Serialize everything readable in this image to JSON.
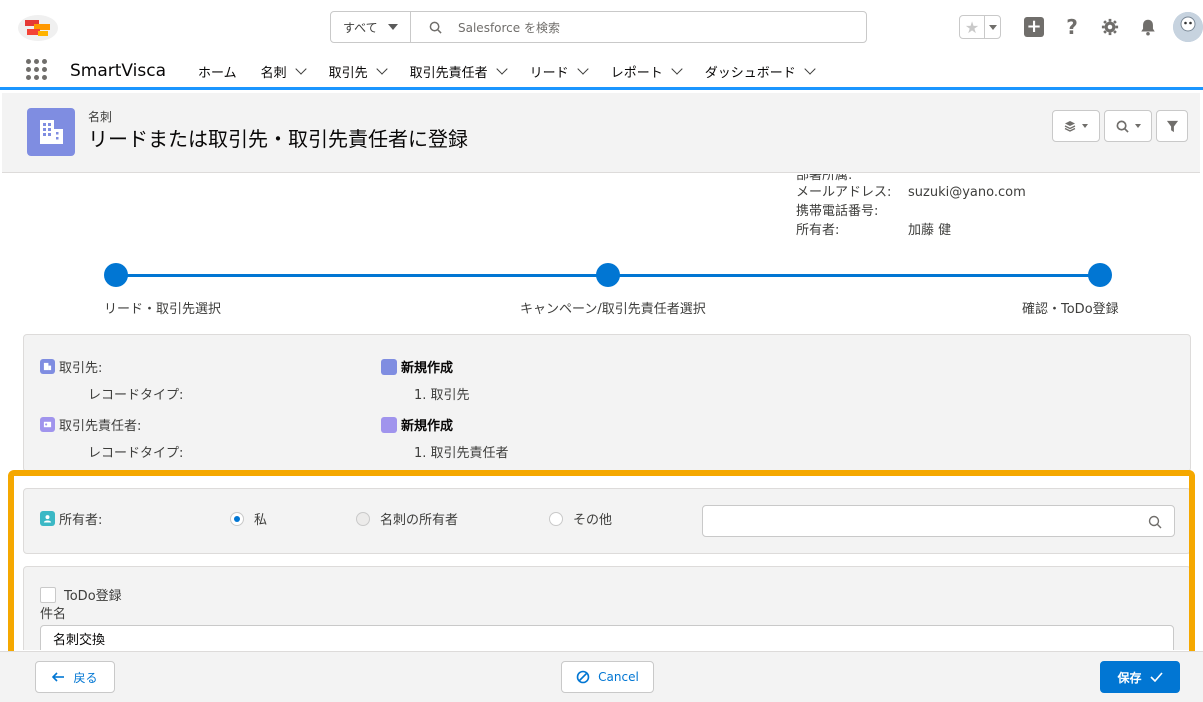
{
  "header": {
    "search_scope": "すべて",
    "search_placeholder": "Salesforce を検索",
    "help": "?"
  },
  "nav": {
    "app_name": "SmartVisca",
    "items": [
      {
        "label": "ホーム",
        "dropdown": false
      },
      {
        "label": "名刺",
        "dropdown": true
      },
      {
        "label": "取引先",
        "dropdown": true
      },
      {
        "label": "取引先責任者",
        "dropdown": true
      },
      {
        "label": "リード",
        "dropdown": true
      },
      {
        "label": "レポート",
        "dropdown": true
      },
      {
        "label": "ダッシュボード",
        "dropdown": true
      }
    ]
  },
  "page": {
    "object_label": "名刺",
    "title": "リードまたは取引先・取引先責任者に登録"
  },
  "info": {
    "cut_label": "部署所属:",
    "rows": [
      {
        "label": "メールアドレス:",
        "value": "suzuki@yano.com"
      },
      {
        "label": "携帯電話番号:",
        "value": ""
      },
      {
        "label": "所有者:",
        "value": "加藤 健"
      }
    ]
  },
  "path": {
    "step1": "リード・取引先選択",
    "step2": "キャンペーン/取引先責任者選択",
    "step3": "確認・ToDo登録"
  },
  "summary": {
    "account_label": "取引先:",
    "account_action": "新規作成",
    "account_rt_label": "レコードタイプ:",
    "account_rt_value": "1.  取引先",
    "contact_label": "取引先責任者:",
    "contact_action": "新規作成",
    "contact_rt_label": "レコードタイプ:",
    "contact_rt_value": "1.  取引先責任者"
  },
  "owner": {
    "label": "所有者:",
    "options": [
      "私",
      "名刺の所有者",
      "その他"
    ],
    "selected": "私"
  },
  "todo": {
    "checkbox_label": "ToDo登録",
    "subject_label": "件名",
    "subject_value": "名刺交換"
  },
  "footer": {
    "back_label": "戻る",
    "cancel_label": "Cancel",
    "save_label": "保存"
  },
  "colors": {
    "brand": "#0176d3",
    "highlight": "#f5a800",
    "object_icon": "#7f8de1"
  }
}
